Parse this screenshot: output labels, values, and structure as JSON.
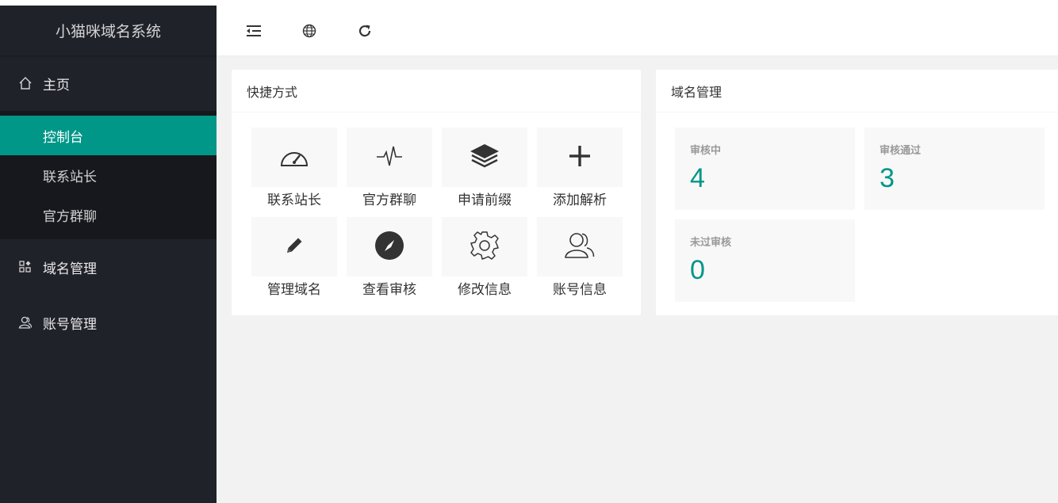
{
  "app": {
    "title": "小猫咪域名系统"
  },
  "sidebar": {
    "home": {
      "label": "主页",
      "icon": "home-icon"
    },
    "home_sub": [
      {
        "label": "控制台",
        "active": true
      },
      {
        "label": "联系站长",
        "active": false
      },
      {
        "label": "官方群聊",
        "active": false
      }
    ],
    "domain": {
      "label": "域名管理",
      "icon": "apps-icon"
    },
    "account": {
      "label": "账号管理",
      "icon": "user-icon"
    }
  },
  "topbar": {
    "icons": [
      "menu-fold-icon",
      "globe-icon",
      "refresh-icon"
    ]
  },
  "shortcut": {
    "title": "快捷方式",
    "items": [
      {
        "label": "联系站长",
        "icon": "dashboard-gauge-icon"
      },
      {
        "label": "官方群聊",
        "icon": "heartbeat-icon"
      },
      {
        "label": "申请前缀",
        "icon": "layers-icon"
      },
      {
        "label": "添加解析",
        "icon": "plus-icon"
      },
      {
        "label": "管理域名",
        "icon": "pencil-icon"
      },
      {
        "label": "查看审核",
        "icon": "compass-icon"
      },
      {
        "label": "修改信息",
        "icon": "gear-icon"
      },
      {
        "label": "账号信息",
        "icon": "users-icon"
      }
    ]
  },
  "domain_mgmt": {
    "title": "域名管理",
    "stats": [
      {
        "label": "审核中",
        "value": "4"
      },
      {
        "label": "审核通过",
        "value": "3"
      },
      {
        "label": "未过审核",
        "value": "0"
      }
    ]
  },
  "colors": {
    "accent": "#009688",
    "sidebar": "#20222a",
    "sidebar_sub": "#17181d",
    "bg": "#f2f2f2"
  }
}
